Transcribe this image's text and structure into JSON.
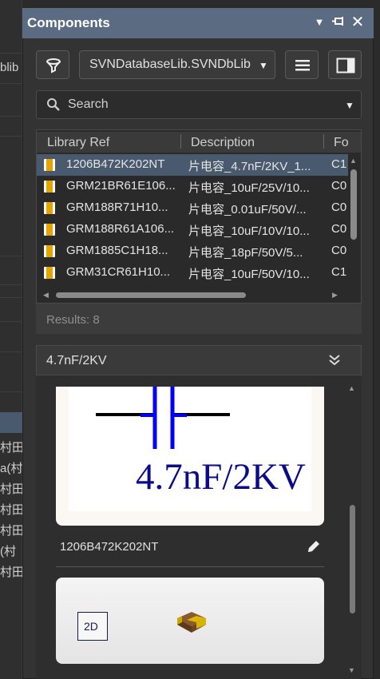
{
  "background_app": {
    "visible_fragments": [
      "blib",
      "村田",
      "a(村",
      "村田",
      "村田)",
      "村田",
      "(村",
      "村田"
    ]
  },
  "panel": {
    "title": "Components",
    "library": "SVNDatabaseLib.SVNDbLib",
    "search_placeholder": "Search",
    "columns": [
      "Library Ref",
      "Description",
      "Fo"
    ],
    "rows": [
      {
        "ref": "1206B472K202NT",
        "desc": "片电容_4.7nF/2KV_1...",
        "foot": "C1",
        "selected": true
      },
      {
        "ref": "GRM21BR61E106...",
        "desc": "片电容_10uF/25V/10...",
        "foot": "C0",
        "selected": false
      },
      {
        "ref": "GRM188R71H10...",
        "desc": "片电容_0.01uF/50V/...",
        "foot": "C0",
        "selected": false
      },
      {
        "ref": "GRM188R61A106...",
        "desc": "片电容_10uF/10V/10...",
        "foot": "C0",
        "selected": false
      },
      {
        "ref": "GRM1885C1H18...",
        "desc": "片电容_18pF/50V/5...",
        "foot": "C0",
        "selected": false
      },
      {
        "ref": "GRM31CR61H10...",
        "desc": "片电容_10uF/50V/10...",
        "foot": "C1",
        "selected": false
      }
    ],
    "results_label": "Results: 8",
    "preview": {
      "title": "4.7nF/2KV",
      "schematic_value": "4.7nF/2KV",
      "component_name": "1206B472K202NT",
      "mode_label": "2D"
    }
  },
  "colors": {
    "titlebar": "#5a6b82",
    "selected_row": "#4a5a6e",
    "capacitor_symbol": "#0000ff",
    "chip_icon": "#e5a400"
  }
}
